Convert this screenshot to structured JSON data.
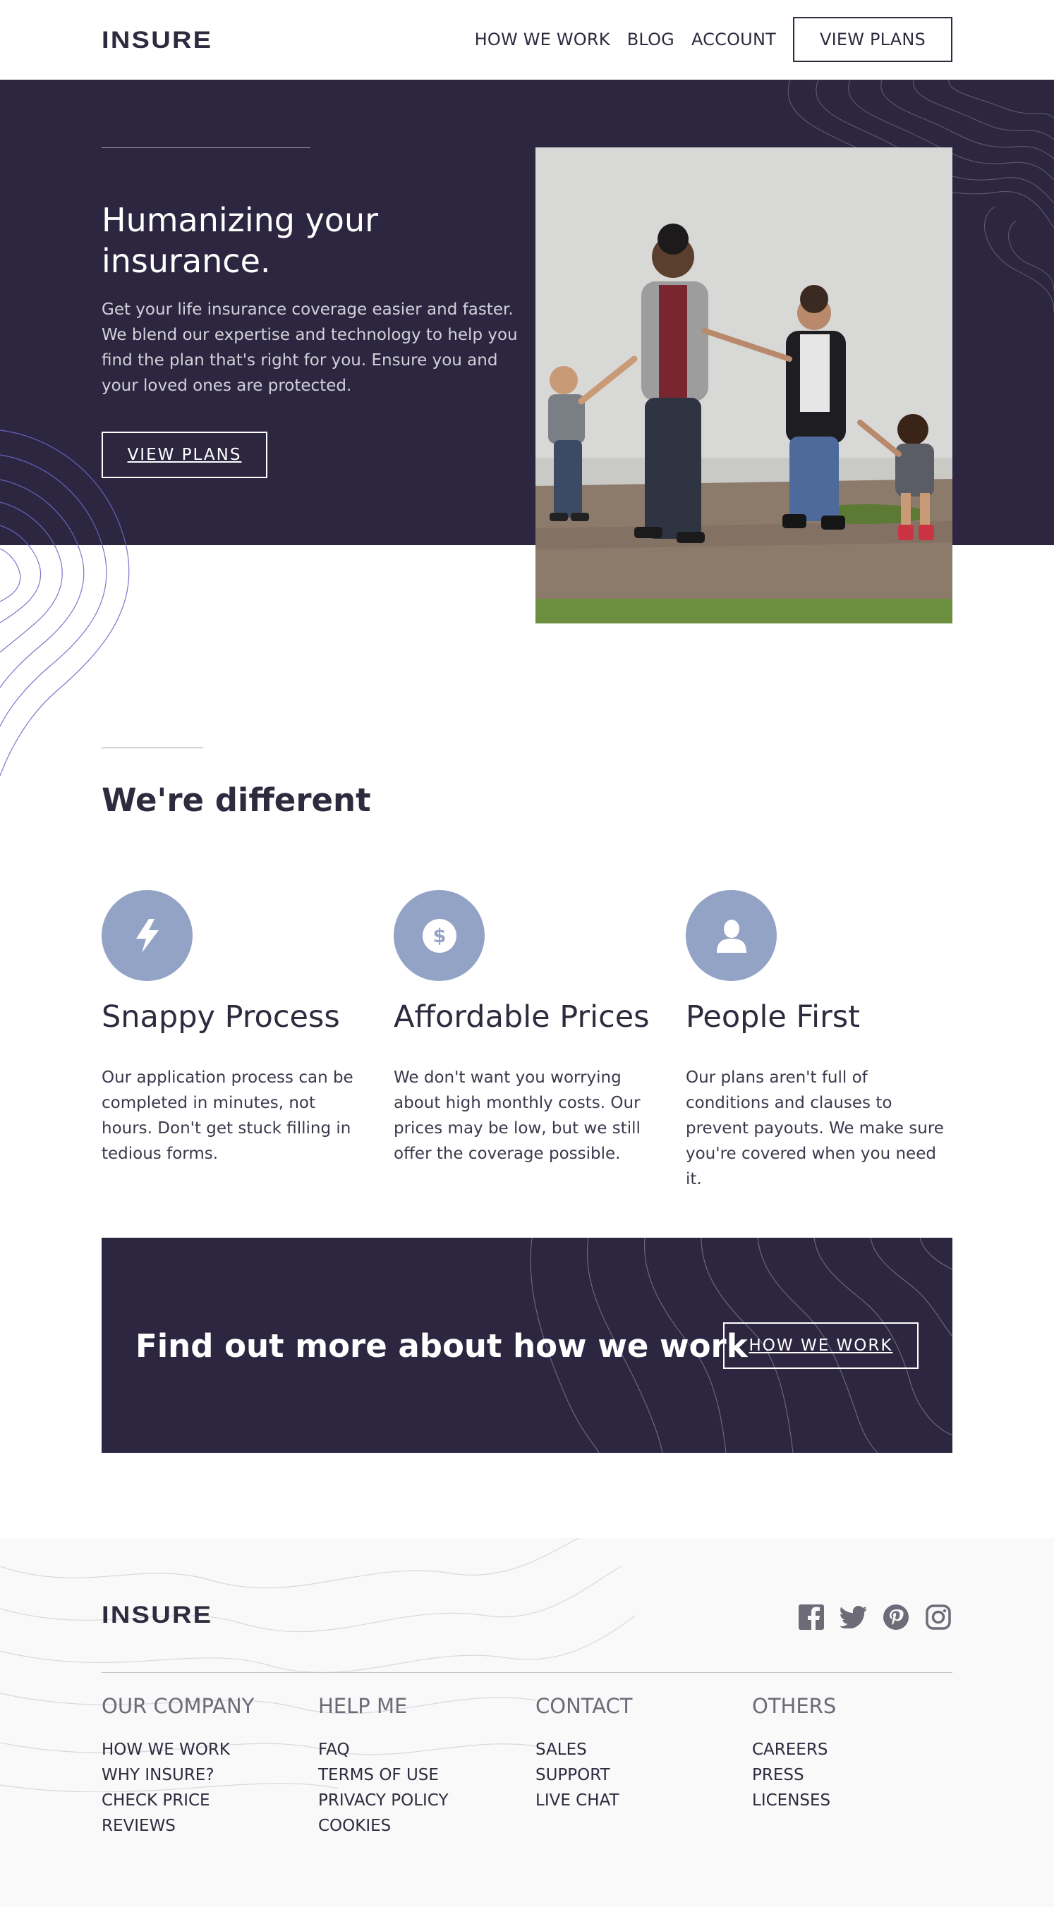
{
  "header": {
    "logo": "INSURE",
    "nav": [
      "HOW WE WORK",
      "BLOG",
      "ACCOUNT"
    ],
    "cta": "VIEW PLANS"
  },
  "hero": {
    "title": "Humanizing your insurance.",
    "text": "Get your life insurance coverage easier and faster. We blend our expertise and technology to help you find the plan that's right for you. Ensure you and your loved ones are protected.",
    "button": "VIEW PLANS",
    "image": "family-walking-photo"
  },
  "different": {
    "title": "We're different",
    "features": [
      {
        "icon": "lightning-icon",
        "title": "Snappy Process",
        "text": "Our application process can be completed in minutes, not hours. Don't get stuck filling in tedious forms."
      },
      {
        "icon": "dollar-icon",
        "title": "Affordable Prices",
        "text": "We don't want you worrying about high monthly costs. Our prices may be low, but we still offer the coverage possible."
      },
      {
        "icon": "person-icon",
        "title": "People First",
        "text": "Our plans aren't full of conditions and clauses to prevent payouts. We make sure you're covered when you need it."
      }
    ]
  },
  "cta": {
    "title": "Find out more about how we work",
    "button": "HOW WE WORK"
  },
  "footer": {
    "logo": "INSURE",
    "socials": [
      "facebook-icon",
      "twitter-icon",
      "pinterest-icon",
      "instagram-icon"
    ],
    "columns": [
      {
        "title": "OUR COMPANY",
        "links": [
          "HOW WE WORK",
          "WHY INSURE?",
          "CHECK PRICE",
          "REVIEWS"
        ]
      },
      {
        "title": "HELP ME",
        "links": [
          "FAQ",
          "TERMS OF USE",
          "PRIVACY POLICY",
          "COOKIES"
        ]
      },
      {
        "title": "CONTACT",
        "links": [
          "SALES",
          "SUPPORT",
          "LIVE CHAT"
        ]
      },
      {
        "title": "OTHERS",
        "links": [
          "CAREERS",
          "PRESS",
          "LICENSES"
        ]
      }
    ]
  },
  "colors": {
    "dark_violet": "#2c2640",
    "icon_blue": "#93a3c6",
    "footer_bg": "#f9f9f9"
  }
}
